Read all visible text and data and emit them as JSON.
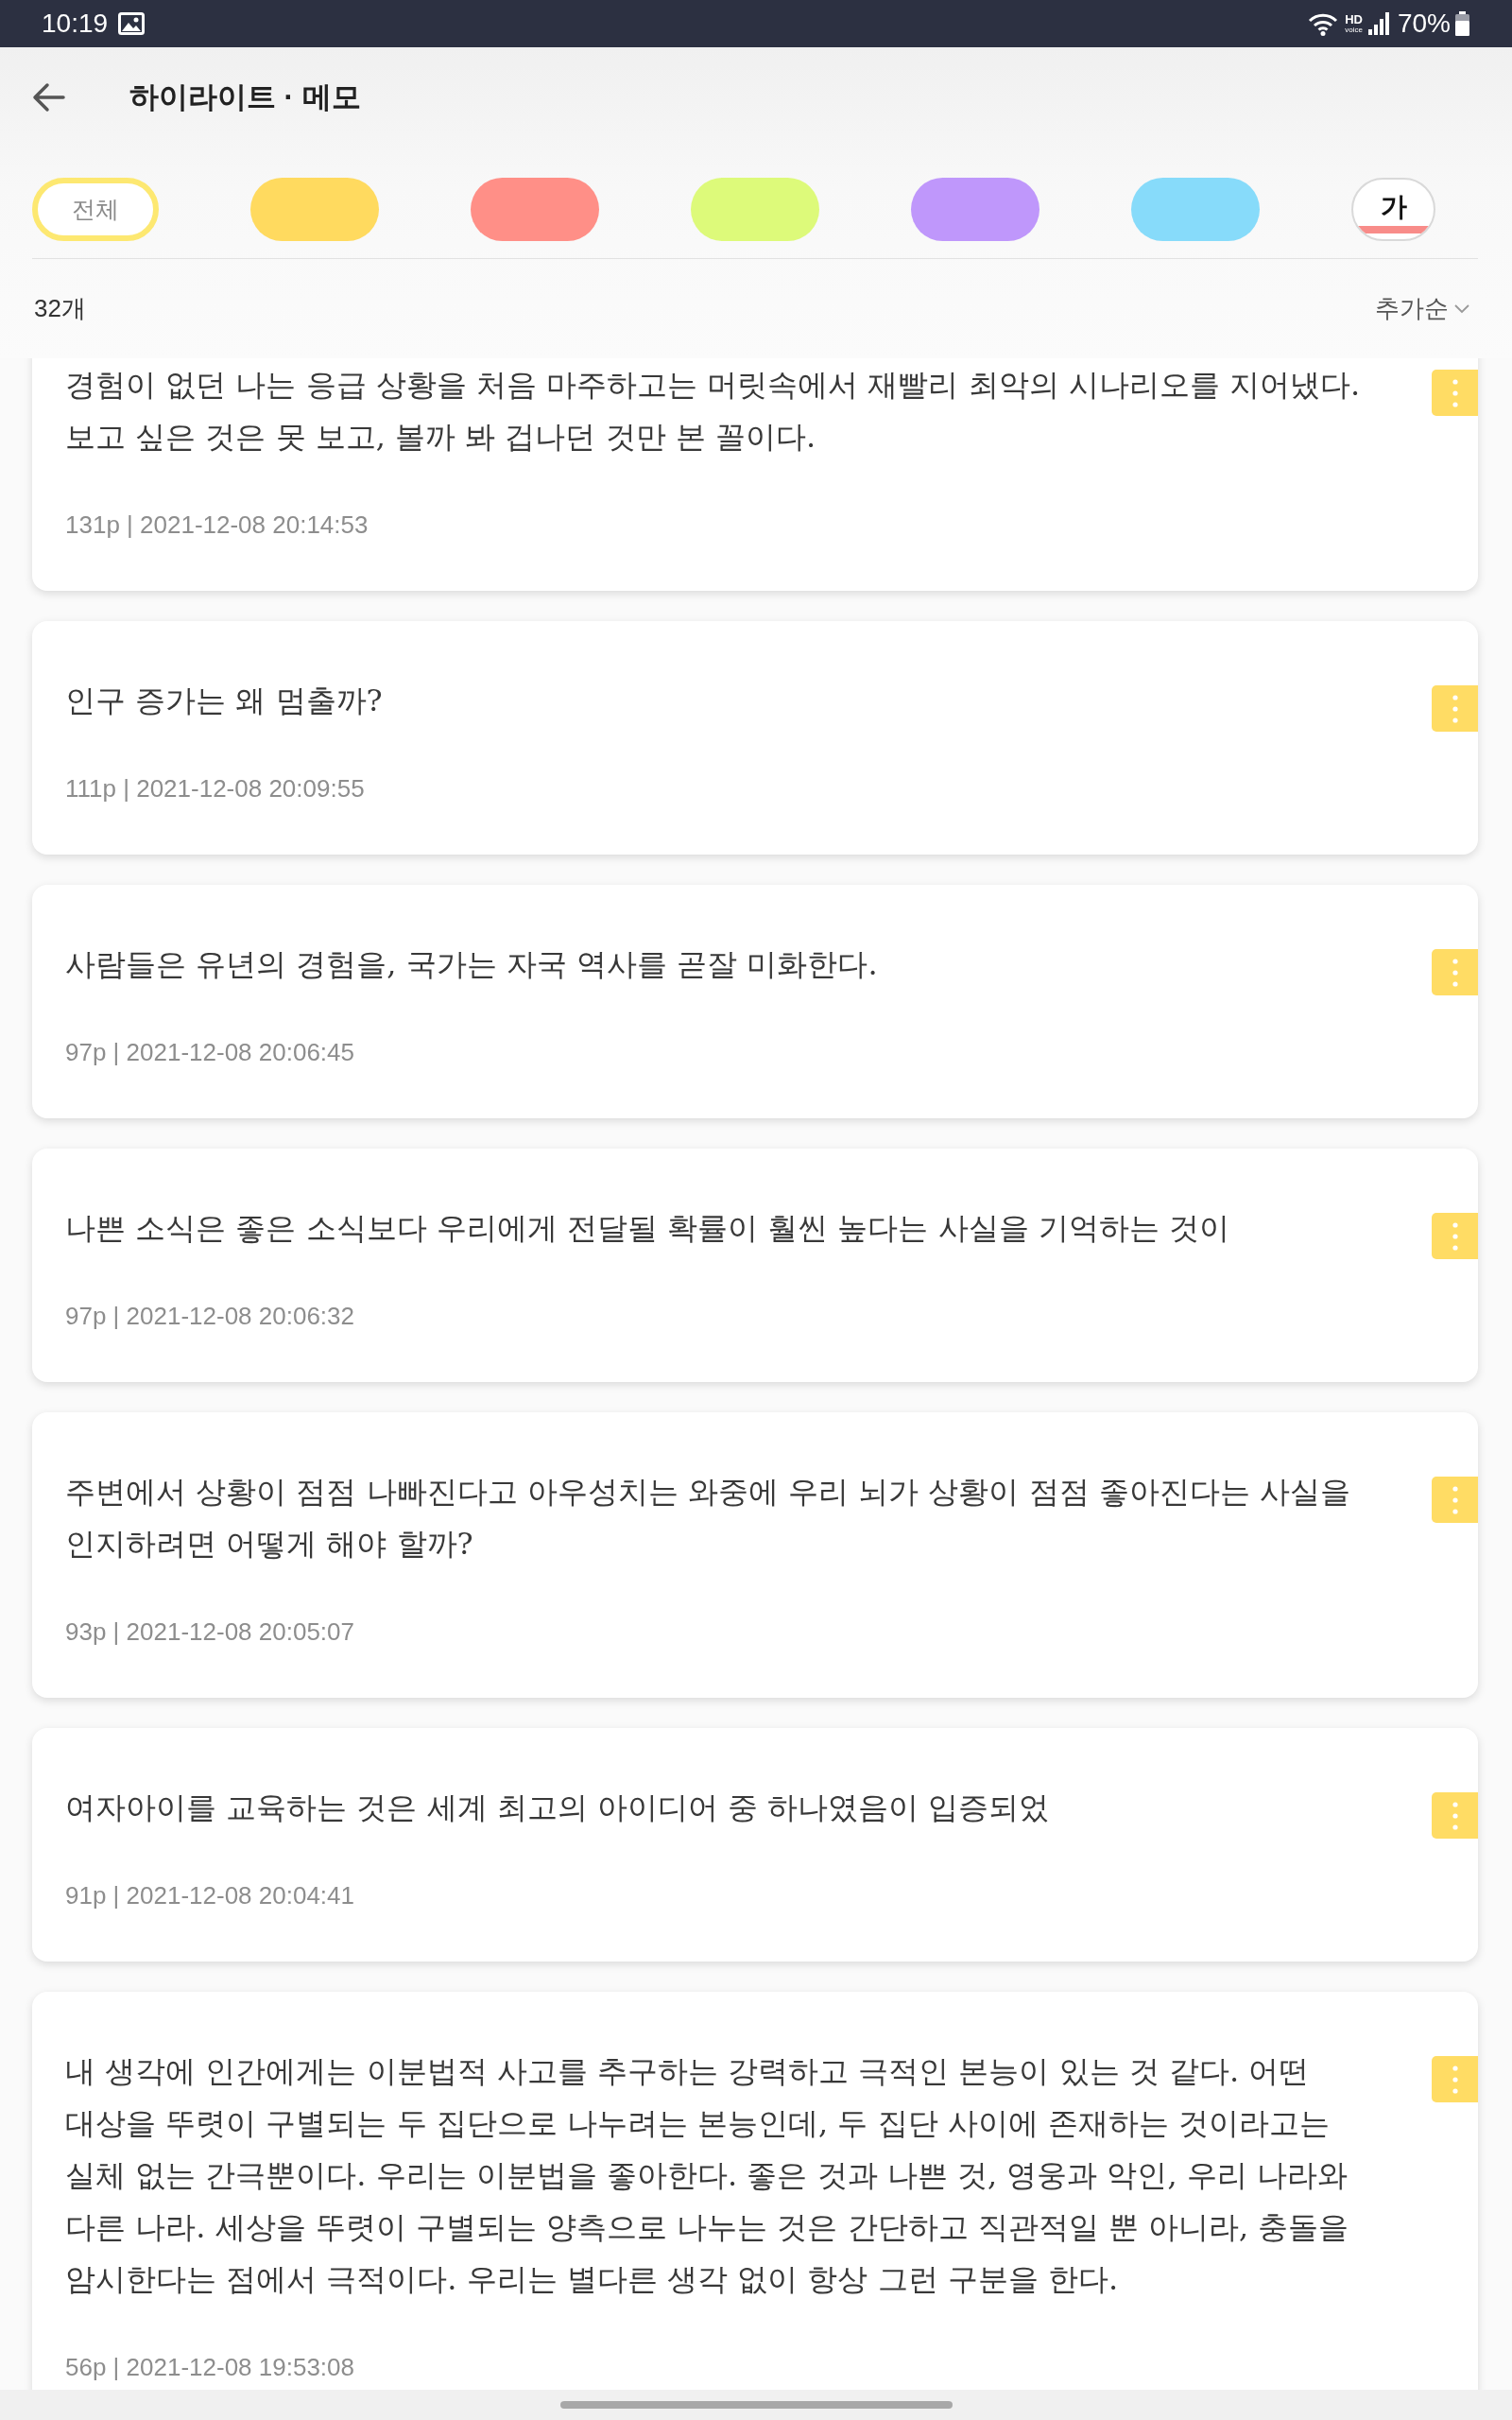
{
  "status_bar": {
    "time": "10:19",
    "hd": "HD",
    "voice": "voice",
    "battery": "70%"
  },
  "header": {
    "title": "하이라이트 · 메모"
  },
  "filters": [
    {
      "kind": "all",
      "label": "전체",
      "selected": true
    },
    {
      "kind": "color",
      "color": "#ffda5f",
      "selected": false
    },
    {
      "kind": "color",
      "color": "#ff8f87",
      "selected": false
    },
    {
      "kind": "color",
      "color": "#ddfa7a",
      "selected": false
    },
    {
      "kind": "color",
      "color": "#bf97fb",
      "selected": false
    },
    {
      "kind": "color",
      "color": "#87dbfa",
      "selected": false
    },
    {
      "kind": "style",
      "label": "가",
      "selected": false
    }
  ],
  "list_header": {
    "count": "32개",
    "sort": "추가순"
  },
  "memos": [
    {
      "text": "경험이 없던 나는 응급 상황을 처음 마주하고는 머릿속에서 재빨리 최악의 시나리오를 지어냈다. 보고 싶은 것은 못 보고, 볼까 봐 겁나던 것만 본 꼴이다.",
      "meta": "131p | 2021-12-08 20:14:53",
      "color": "#ffdc64"
    },
    {
      "text": "인구 증가는 왜 멈출까?",
      "meta": "111p | 2021-12-08 20:09:55",
      "color": "#ffdc64"
    },
    {
      "text": "사람들은 유년의 경험을, 국가는 자국 역사를 곧잘 미화한다.",
      "meta": "97p | 2021-12-08 20:06:45",
      "color": "#ffdc64"
    },
    {
      "text": "나쁜 소식은 좋은 소식보다 우리에게 전달될 확률이 훨씬 높다는 사실을 기억하는 것이",
      "meta": "97p | 2021-12-08 20:06:32",
      "color": "#ffdc64"
    },
    {
      "text": "주변에서 상황이 점점 나빠진다고 아우성치는 와중에 우리 뇌가 상황이 점점 좋아진다는 사실을 인지하려면 어떻게 해야 할까?",
      "meta": "93p | 2021-12-08 20:05:07",
      "color": "#ffdc64"
    },
    {
      "text": "여자아이를 교육하는 것은 세계 최고의 아이디어 중 하나였음이 입증되었",
      "meta": "91p | 2021-12-08 20:04:41",
      "color": "#ffdc64"
    },
    {
      "text": "내 생각에 인간에게는 이분법적 사고를 추구하는 강력하고 극적인 본능이 있는 것 같다. 어떤 대상을 뚜렷이 구별되는 두 집단으로 나누려는 본능인데, 두 집단 사이에 존재하는 것이라고는 실체 없는 간극뿐이다. 우리는 이분법을 좋아한다. 좋은 것과 나쁜 것, 영웅과 악인, 우리 나라와 다른 나라. 세상을 뚜렷이 구별되는 양측으로 나누는 것은 간단하고 직관적일 뿐 아니라, 충돌을 암시한다는 점에서 극적이다. 우리는 별다른 생각 없이 항상 그런 구분을 한다.",
      "meta": "56p | 2021-12-08 19:53:08",
      "color": "#ffdc64"
    }
  ]
}
